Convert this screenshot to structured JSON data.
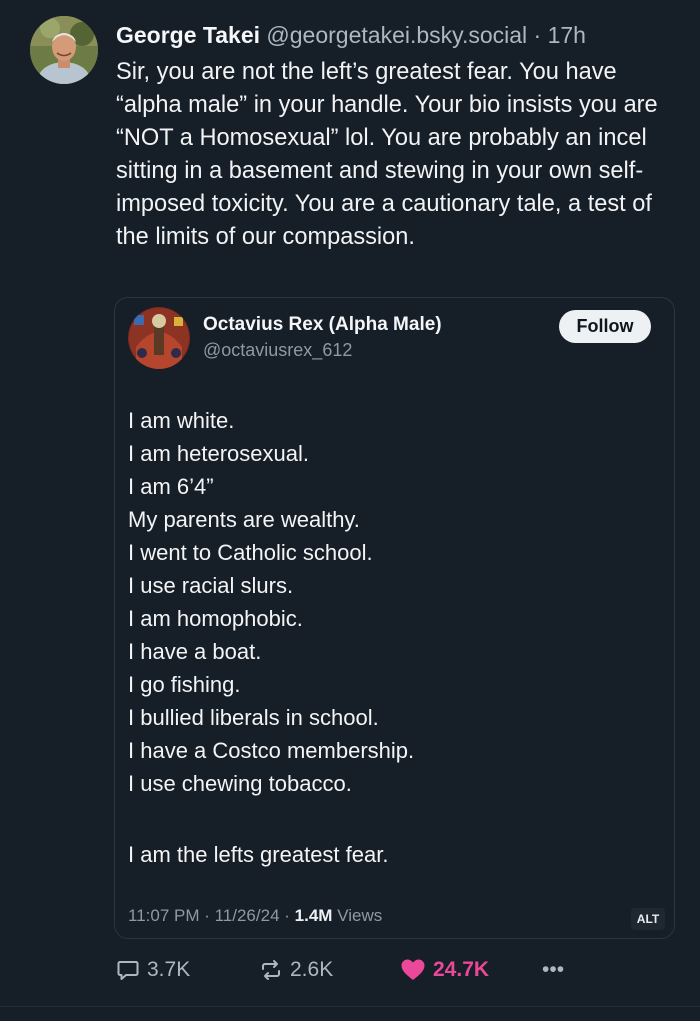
{
  "post": {
    "author_name": "George Takei",
    "author_handle": "@georgetakei.bsky.social",
    "separator": "·",
    "time_ago": "17h",
    "text": "Sir, you are not the left’s greatest fear. You have “alpha male” in your handle. Your bio insists you are “NOT a Homosexual” lol. You are probably an incel sitting in a basement and stewing in your own self-imposed toxicity. You are a cautionary tale, a test of the limits of our compassion."
  },
  "quote": {
    "author_name": "Octavius Rex (Alpha Male)",
    "author_handle": "@octaviusrex_612",
    "follow_label": "Follow",
    "lines": [
      "I am white.",
      "I am heterosexual.",
      "I am 6’4”",
      "My parents are wealthy.",
      "I went to Catholic school.",
      "I use racial slurs.",
      "I am homophobic.",
      "I have a boat.",
      "I go fishing.",
      "I bullied liberals in school.",
      "I have a Costco membership.",
      "I use chewing tobacco."
    ],
    "closing_line": "I am the lefts greatest fear.",
    "timestamp": "11:07 PM · 11/26/24 ·",
    "views_count": "1.4M",
    "views_label": "Views",
    "alt_badge": "ALT"
  },
  "actions": {
    "reply_count": "3.7K",
    "repost_count": "2.6K",
    "like_count": "24.7K",
    "more_label": "•••"
  },
  "icons": {
    "reply": "reply-icon",
    "repost": "repost-icon",
    "like": "heart-icon",
    "more": "more-icon"
  },
  "colors": {
    "background": "#161e27",
    "like_accent": "#ec4899",
    "muted_text": "#aeb7c1"
  }
}
